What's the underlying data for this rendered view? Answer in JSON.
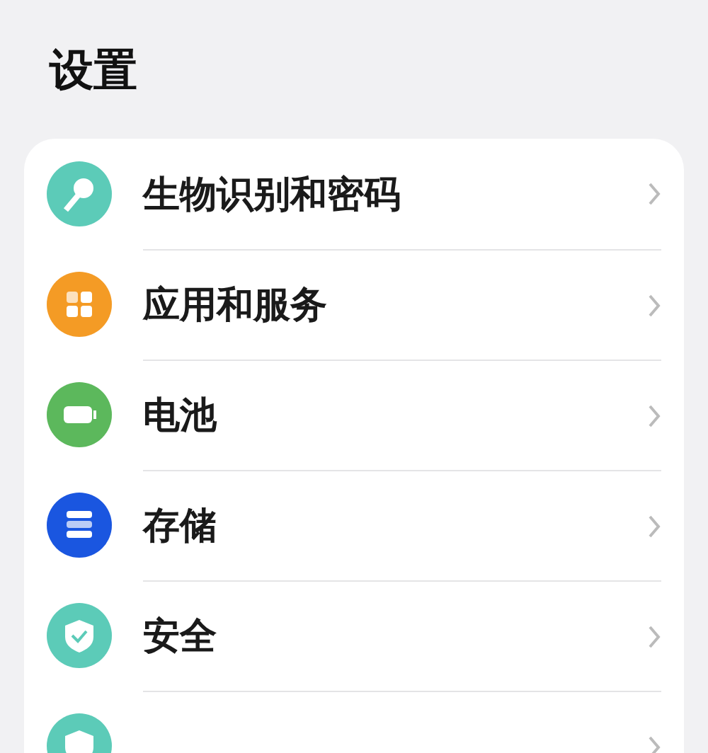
{
  "title": "设置",
  "items": [
    {
      "label": "生物识别和密码",
      "kind": "key",
      "color": "#5ccbb8"
    },
    {
      "label": "应用和服务",
      "kind": "apps",
      "color": "#f49b25"
    },
    {
      "label": "电池",
      "kind": "battery",
      "color": "#5cb85c"
    },
    {
      "label": "存储",
      "kind": "storage",
      "color": "#1a56e0"
    },
    {
      "label": "安全",
      "kind": "shield",
      "color": "#5ccbb8"
    },
    {
      "kind": "privacy",
      "color": "#5ccbb8"
    }
  ]
}
